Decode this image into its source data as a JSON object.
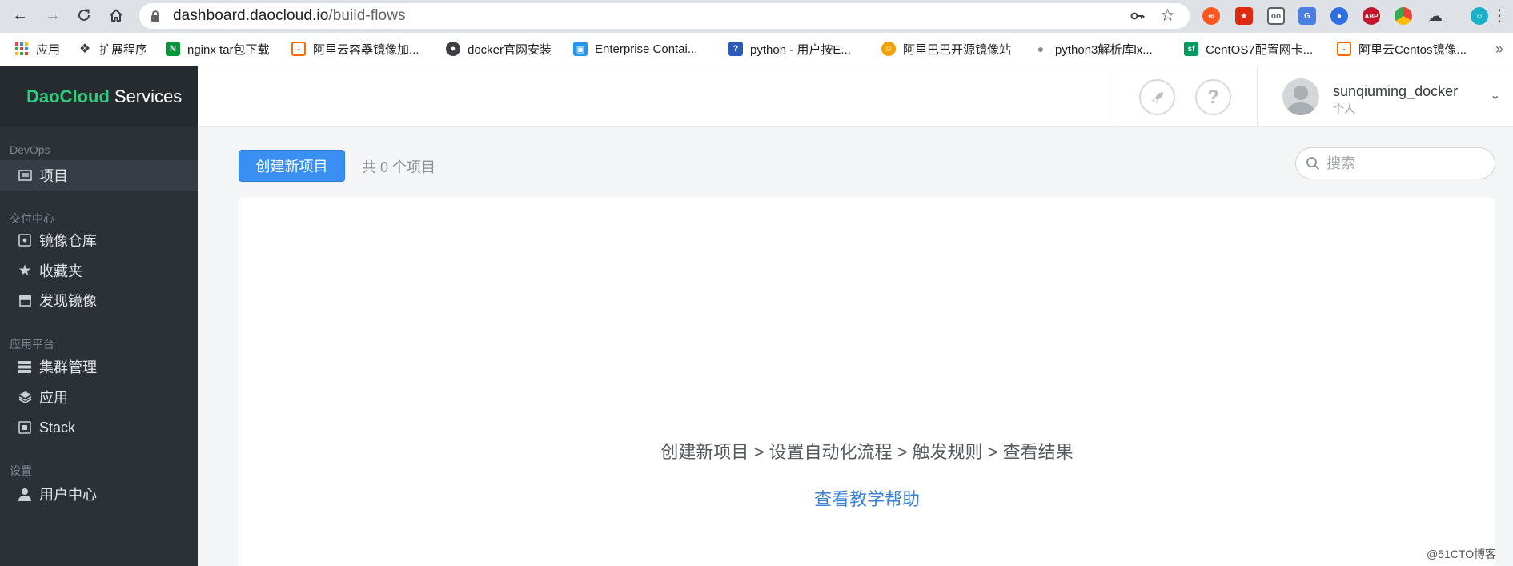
{
  "browser": {
    "url_domain": "dashboard.daocloud.io",
    "url_path": "/build-flows",
    "bookmarks": [
      {
        "label": "应用",
        "icon": "apps-grid-icon",
        "color": "#4285f4"
      },
      {
        "label": "扩展程序",
        "icon": "puzzle-icon",
        "color": "#5f6368"
      },
      {
        "label": "nginx tar包下载",
        "icon": "nginx-icon",
        "color": "#009639"
      },
      {
        "label": "阿里云容器镜像加...",
        "icon": "aliyun-icon",
        "color": "#ff6a00"
      },
      {
        "label": "docker官网安装",
        "icon": "globe-icon",
        "color": "#3c4043"
      },
      {
        "label": "Enterprise Contai...",
        "icon": "docker-icon",
        "color": "#2496ed"
      },
      {
        "label": "python - 用户按E...",
        "icon": "chat-icon",
        "color": "#2b5bb8"
      },
      {
        "label": "阿里巴巴开源镜像站",
        "icon": "alibaba-icon",
        "color": "#f4a100"
      },
      {
        "label": "python3解析库lx...",
        "icon": "github-icon",
        "color": "#555"
      },
      {
        "label": "CentOS7配置网卡...",
        "icon": "sf-icon",
        "color": "#009a61"
      },
      {
        "label": "阿里云Centos镜像...",
        "icon": "aliyun-icon",
        "color": "#ff6a00"
      }
    ]
  },
  "app": {
    "brand_primary": "DaoCloud",
    "brand_secondary": "Services",
    "accent_color": "#3c8ff2"
  },
  "sidebar": {
    "sections": [
      {
        "title": "DevOps",
        "items": [
          {
            "label": "项目",
            "icon": "list-icon",
            "active": true
          }
        ]
      },
      {
        "title": "交付中心",
        "items": [
          {
            "label": "镜像仓库",
            "icon": "image-box-icon"
          },
          {
            "label": "收藏夹",
            "icon": "star-icon"
          },
          {
            "label": "发现镜像",
            "icon": "store-icon"
          }
        ]
      },
      {
        "title": "应用平台",
        "items": [
          {
            "label": "集群管理",
            "icon": "server-icon"
          },
          {
            "label": "应用",
            "icon": "layers-icon"
          },
          {
            "label": "Stack",
            "icon": "stack-icon"
          }
        ]
      },
      {
        "title": "设置",
        "items": [
          {
            "label": "用户中心",
            "icon": "user-icon"
          }
        ]
      }
    ]
  },
  "header": {
    "username": "sunqiuming_docker",
    "user_type": "个人"
  },
  "main": {
    "create_button": "创建新项目",
    "project_count_text": "共 0 个项目",
    "search_placeholder": "搜索",
    "empty_steps": "创建新项目 > 设置自动化流程 > 触发规则 > 查看结果",
    "help_link": "查看教学帮助"
  },
  "watermark": "@51CTO博客"
}
